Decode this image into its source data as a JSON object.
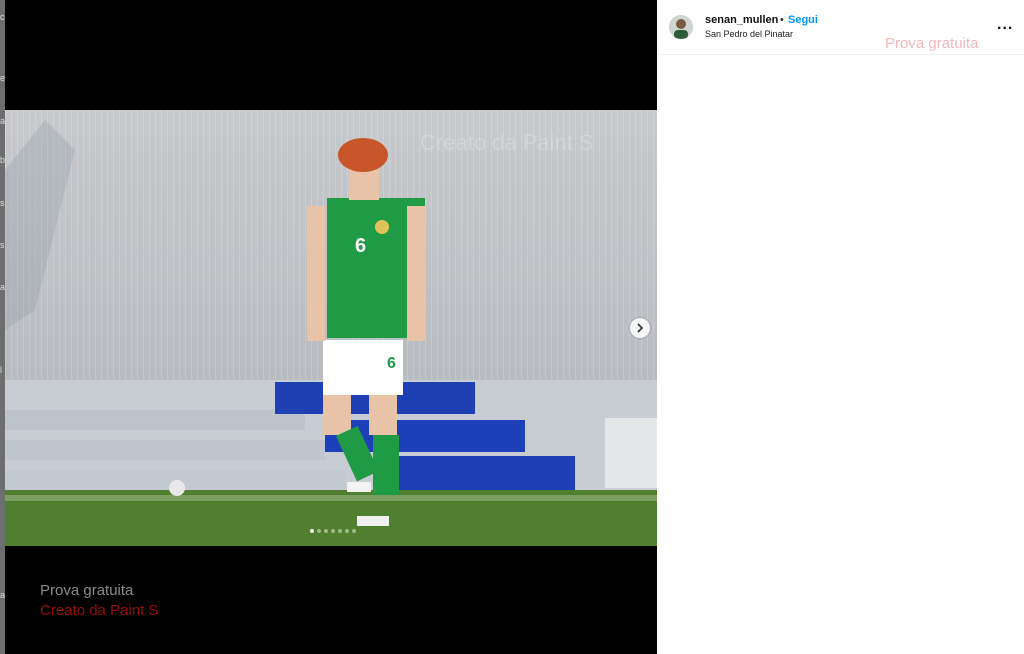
{
  "post": {
    "username": "senan_mullen",
    "separator": "•",
    "follow_label": "Segui",
    "location": "San Pedro del Pinatar",
    "more_label": "..."
  },
  "carousel": {
    "slide_count": 7,
    "active_index": 0,
    "next_icon": "chevron-right-icon"
  },
  "player": {
    "shirt_number": "6",
    "shorts_number": "6"
  },
  "watermarks": {
    "top": "Creato da Paint S",
    "bottom_line1": "Prova gratuita",
    "bottom_line2": "Creato da Paint S",
    "sidebar": "Prova gratuita"
  },
  "background_fragments": [
    "c",
    "e",
    "a",
    "b",
    "s",
    "s",
    "a",
    "l",
    "a"
  ],
  "colors": {
    "follow": "#0095f6",
    "jersey": "#1f9a45"
  }
}
